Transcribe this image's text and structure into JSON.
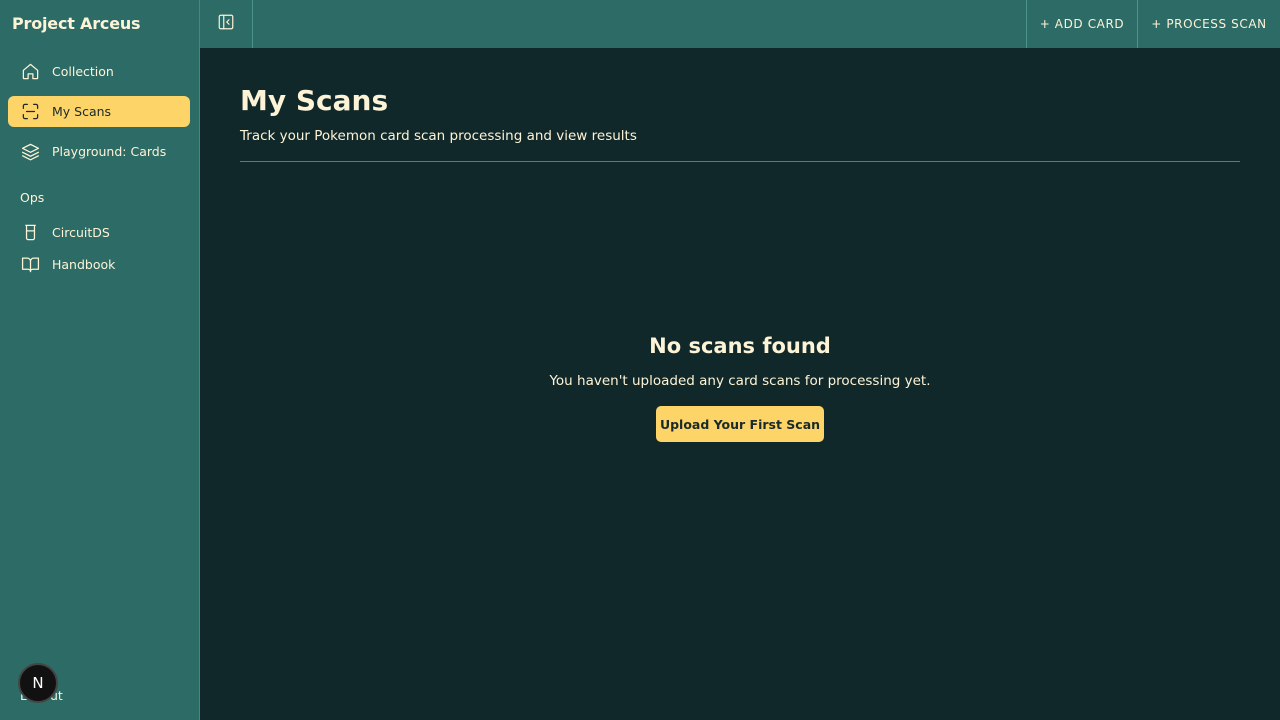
{
  "app": {
    "title": "Project Arceus"
  },
  "sidebar": {
    "items": [
      {
        "label": "Collection",
        "icon": "home-icon"
      },
      {
        "label": "My Scans",
        "icon": "scan-icon",
        "active": true
      },
      {
        "label": "Playground: Cards",
        "icon": "layers-icon"
      }
    ],
    "ops_label": "Ops",
    "ops_items": [
      {
        "label": "CircuitDS",
        "icon": "beaker-icon"
      },
      {
        "label": "Handbook",
        "icon": "book-icon"
      }
    ],
    "logout_label": "Logout",
    "badge_letter": "N"
  },
  "topbar": {
    "add_card_label": "+ ADD CARD",
    "process_scan_label": "+ PROCESS SCAN"
  },
  "main": {
    "title": "My Scans",
    "subtitle": "Track your Pokemon card scan processing and view results",
    "empty": {
      "title": "No scans found",
      "message": "You haven't uploaded any card scans for processing yet.",
      "button_label": "Upload Your First Scan"
    }
  },
  "colors": {
    "sidebar_bg": "#2d6b67",
    "main_bg": "#11282a",
    "accent": "#fcd468",
    "text": "#fdf3d6"
  }
}
